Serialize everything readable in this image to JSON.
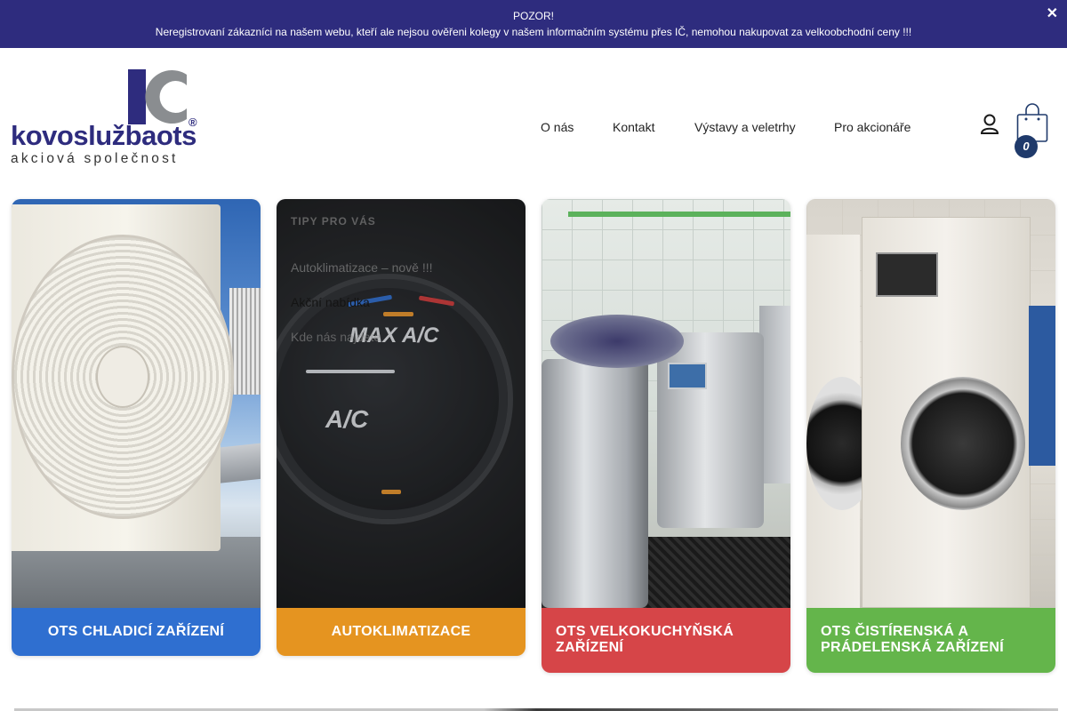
{
  "notice": {
    "title": "POZOR!",
    "message": "Neregistrovaní zákazníci na našem webu, kteří ale nejsou ověřeni kolegy v našem informačním systému přes IČ, nemohou nakupovat za velkoobchodní ceny !!!",
    "close_icon": "close-icon",
    "background_color": "#2e2c7e"
  },
  "logo": {
    "name": "kovoslužbaots",
    "registered": "®",
    "tagline": "akciová společnost",
    "brand_color": "#2e2c7e"
  },
  "nav": {
    "items": [
      {
        "label": "O nás"
      },
      {
        "label": "Kontakt"
      },
      {
        "label": "Výstavy a veletrhy"
      },
      {
        "label": "Pro akcionáře"
      }
    ],
    "search_icon": "search-icon",
    "search_glyph": "",
    "user_icon": "user-icon",
    "cart_icon": "shopping-bag-icon",
    "cart_count": "0"
  },
  "cards": [
    {
      "label": "OTS CHLADICÍ ZAŘÍZENÍ",
      "color": "#2f6fd0"
    },
    {
      "label": "AUTOKLIMATIZACE",
      "color": "#e59420",
      "image_text_1": "MAX A/C",
      "image_text_2": "A/C",
      "dropdown": {
        "title": "TIPY PRO VÁS",
        "items": [
          {
            "label": "Autoklimatizace – nově !!!"
          },
          {
            "label": "Akční nabídka"
          },
          {
            "label": "Kde nás najdete"
          }
        ]
      }
    },
    {
      "label": "OTS VELKOKUCHYŇSKÁ ZAŘÍZENÍ",
      "color": "#d64548"
    },
    {
      "label": "OTS ČISTÍRENSKÁ A PRÁDELENSKÁ ZAŘÍZENÍ",
      "color": "#64b54b"
    }
  ]
}
